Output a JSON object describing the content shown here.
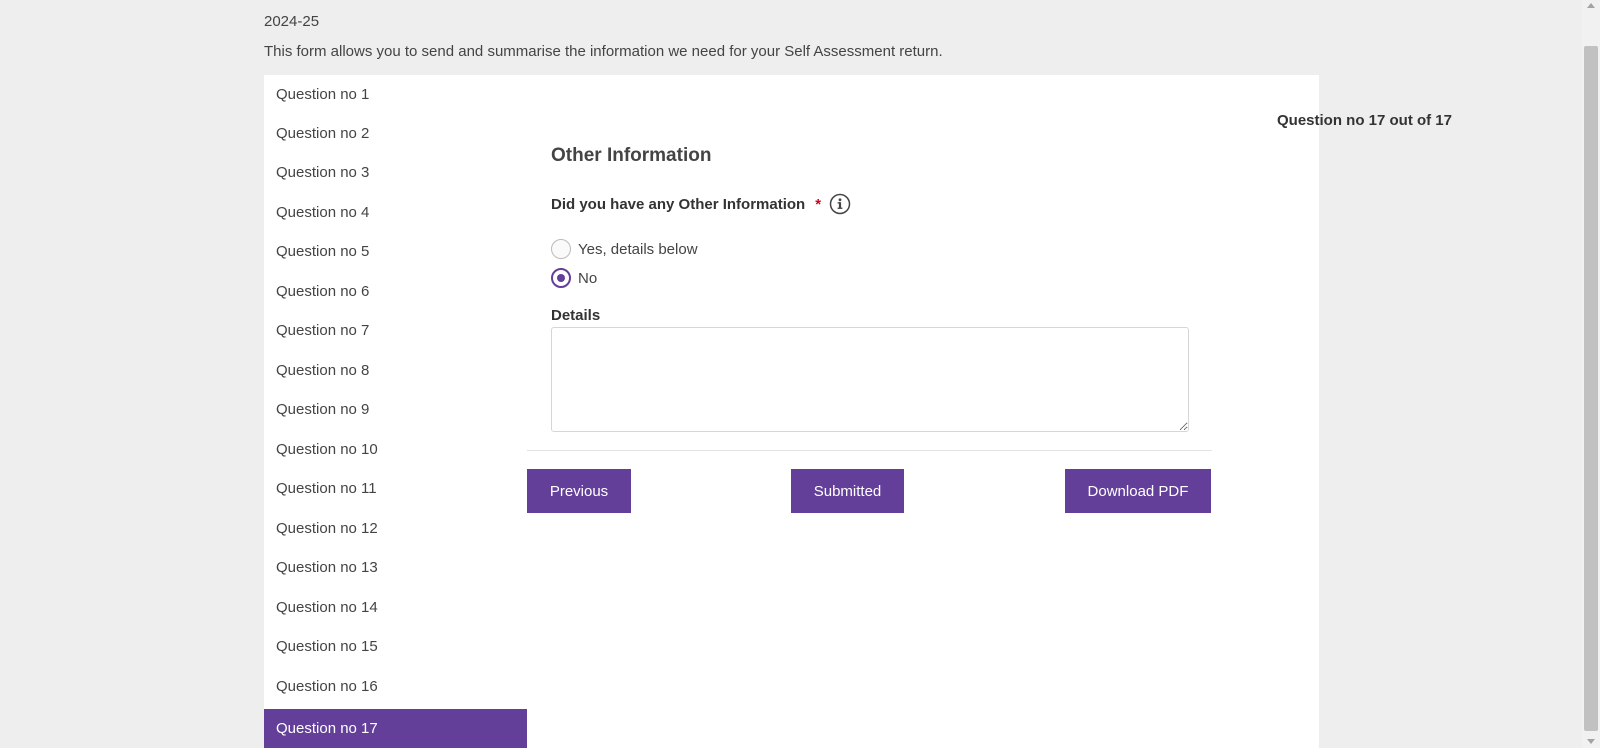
{
  "header": {
    "year": "2024-25",
    "intro": "This form allows you to send and summarise the information we need for your Self Assessment return."
  },
  "sidebar": {
    "items": [
      {
        "label": "Question no 1"
      },
      {
        "label": "Question no 2"
      },
      {
        "label": "Question no 3"
      },
      {
        "label": "Question no 4"
      },
      {
        "label": "Question no 5"
      },
      {
        "label": "Question no 6"
      },
      {
        "label": "Question no 7"
      },
      {
        "label": "Question no 8"
      },
      {
        "label": "Question no 9"
      },
      {
        "label": "Question no 10"
      },
      {
        "label": "Question no 11"
      },
      {
        "label": "Question no 12"
      },
      {
        "label": "Question no 13"
      },
      {
        "label": "Question no 14"
      },
      {
        "label": "Question no 15"
      },
      {
        "label": "Question no 16"
      },
      {
        "label": "Question no 17"
      }
    ],
    "active_index": 16
  },
  "main": {
    "counter": "Question no 17 out of 17",
    "section_title": "Other Information",
    "question": "Did you have any Other Information",
    "required_mark": "*",
    "info_icon": "info-circle-icon",
    "options": [
      {
        "label": "Yes, details below",
        "checked": false
      },
      {
        "label": "No",
        "checked": true
      }
    ],
    "details_label": "Details",
    "details_value": "",
    "buttons": {
      "previous": "Previous",
      "submitted": "Submitted",
      "download": "Download PDF"
    }
  },
  "colors": {
    "accent": "#633f99",
    "required": "#d0021b",
    "background": "#eeeeee"
  }
}
